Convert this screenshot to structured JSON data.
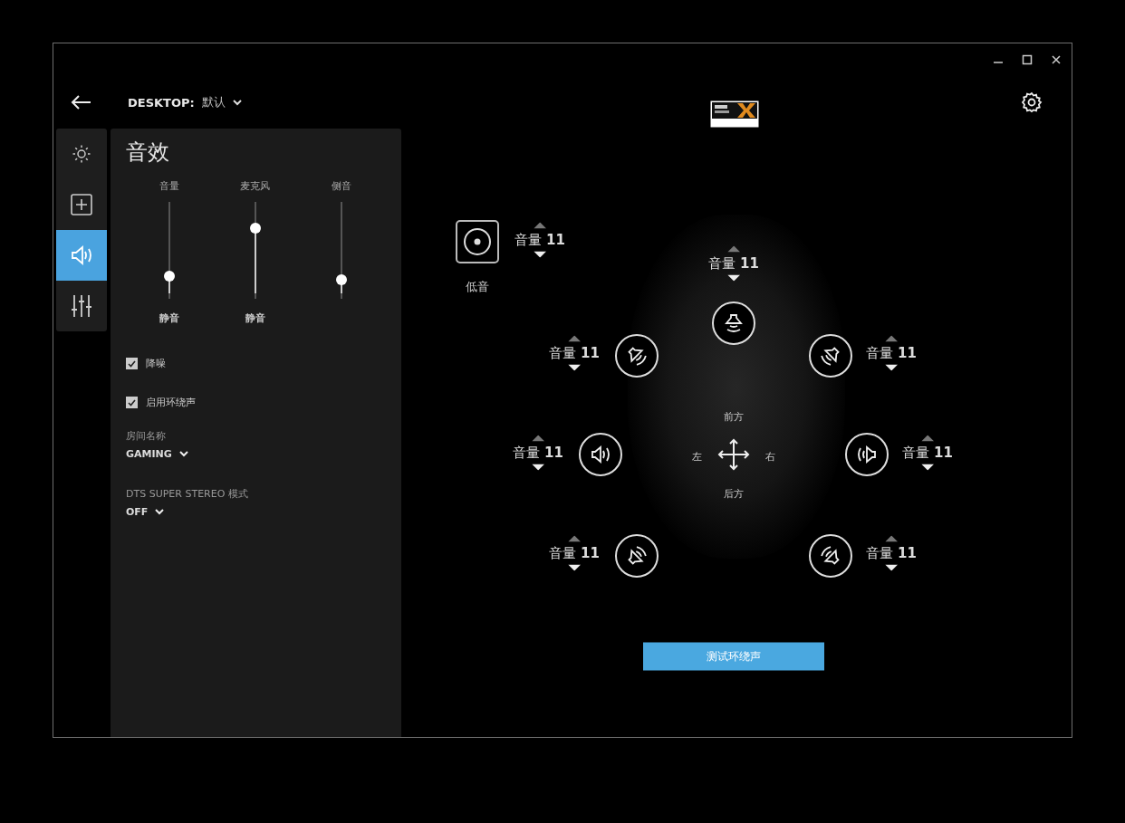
{
  "header": {
    "profile_label": "DESKTOP:",
    "profile_name": "默认"
  },
  "nav": [
    {
      "kind": "lighting",
      "selected": false
    },
    {
      "kind": "assignments",
      "selected": false
    },
    {
      "kind": "audio",
      "selected": true
    },
    {
      "kind": "equalizer",
      "selected": false
    }
  ],
  "panel": {
    "title": "音效",
    "sliders": [
      {
        "label": "音量",
        "level": 0.2,
        "reading": "静音"
      },
      {
        "label": "麦克风",
        "level": 0.76,
        "reading": "静音"
      },
      {
        "label": "侧音",
        "level": 0.16
      }
    ],
    "checkboxes": [
      {
        "label": "降噪",
        "checked": true
      },
      {
        "label": "启用环绕声",
        "checked": true
      }
    ],
    "dropdowns": [
      {
        "label": "房间名称",
        "value": "GAMING"
      },
      {
        "label": "DTS SUPER STEREO 模式",
        "value": "OFF"
      }
    ]
  },
  "subwoofer": {
    "label": "低音",
    "volume": "音量 **11**"
  },
  "speakers": {
    "center": {
      "volume": "音量 **11**"
    },
    "front_left": {
      "volume": "音量 **11**"
    },
    "front_right": {
      "volume": "音量 **11**"
    },
    "side_left": {
      "volume": "音量 **11**"
    },
    "side_right": {
      "volume": "音量 **11**"
    },
    "rear_left": {
      "volume": "音量 **11**"
    },
    "rear_right": {
      "volume": "音量 **11**"
    }
  },
  "directions": {
    "front": "前方",
    "left": "左",
    "right": "右",
    "back": "后方"
  },
  "test_button": "测试环绕声"
}
